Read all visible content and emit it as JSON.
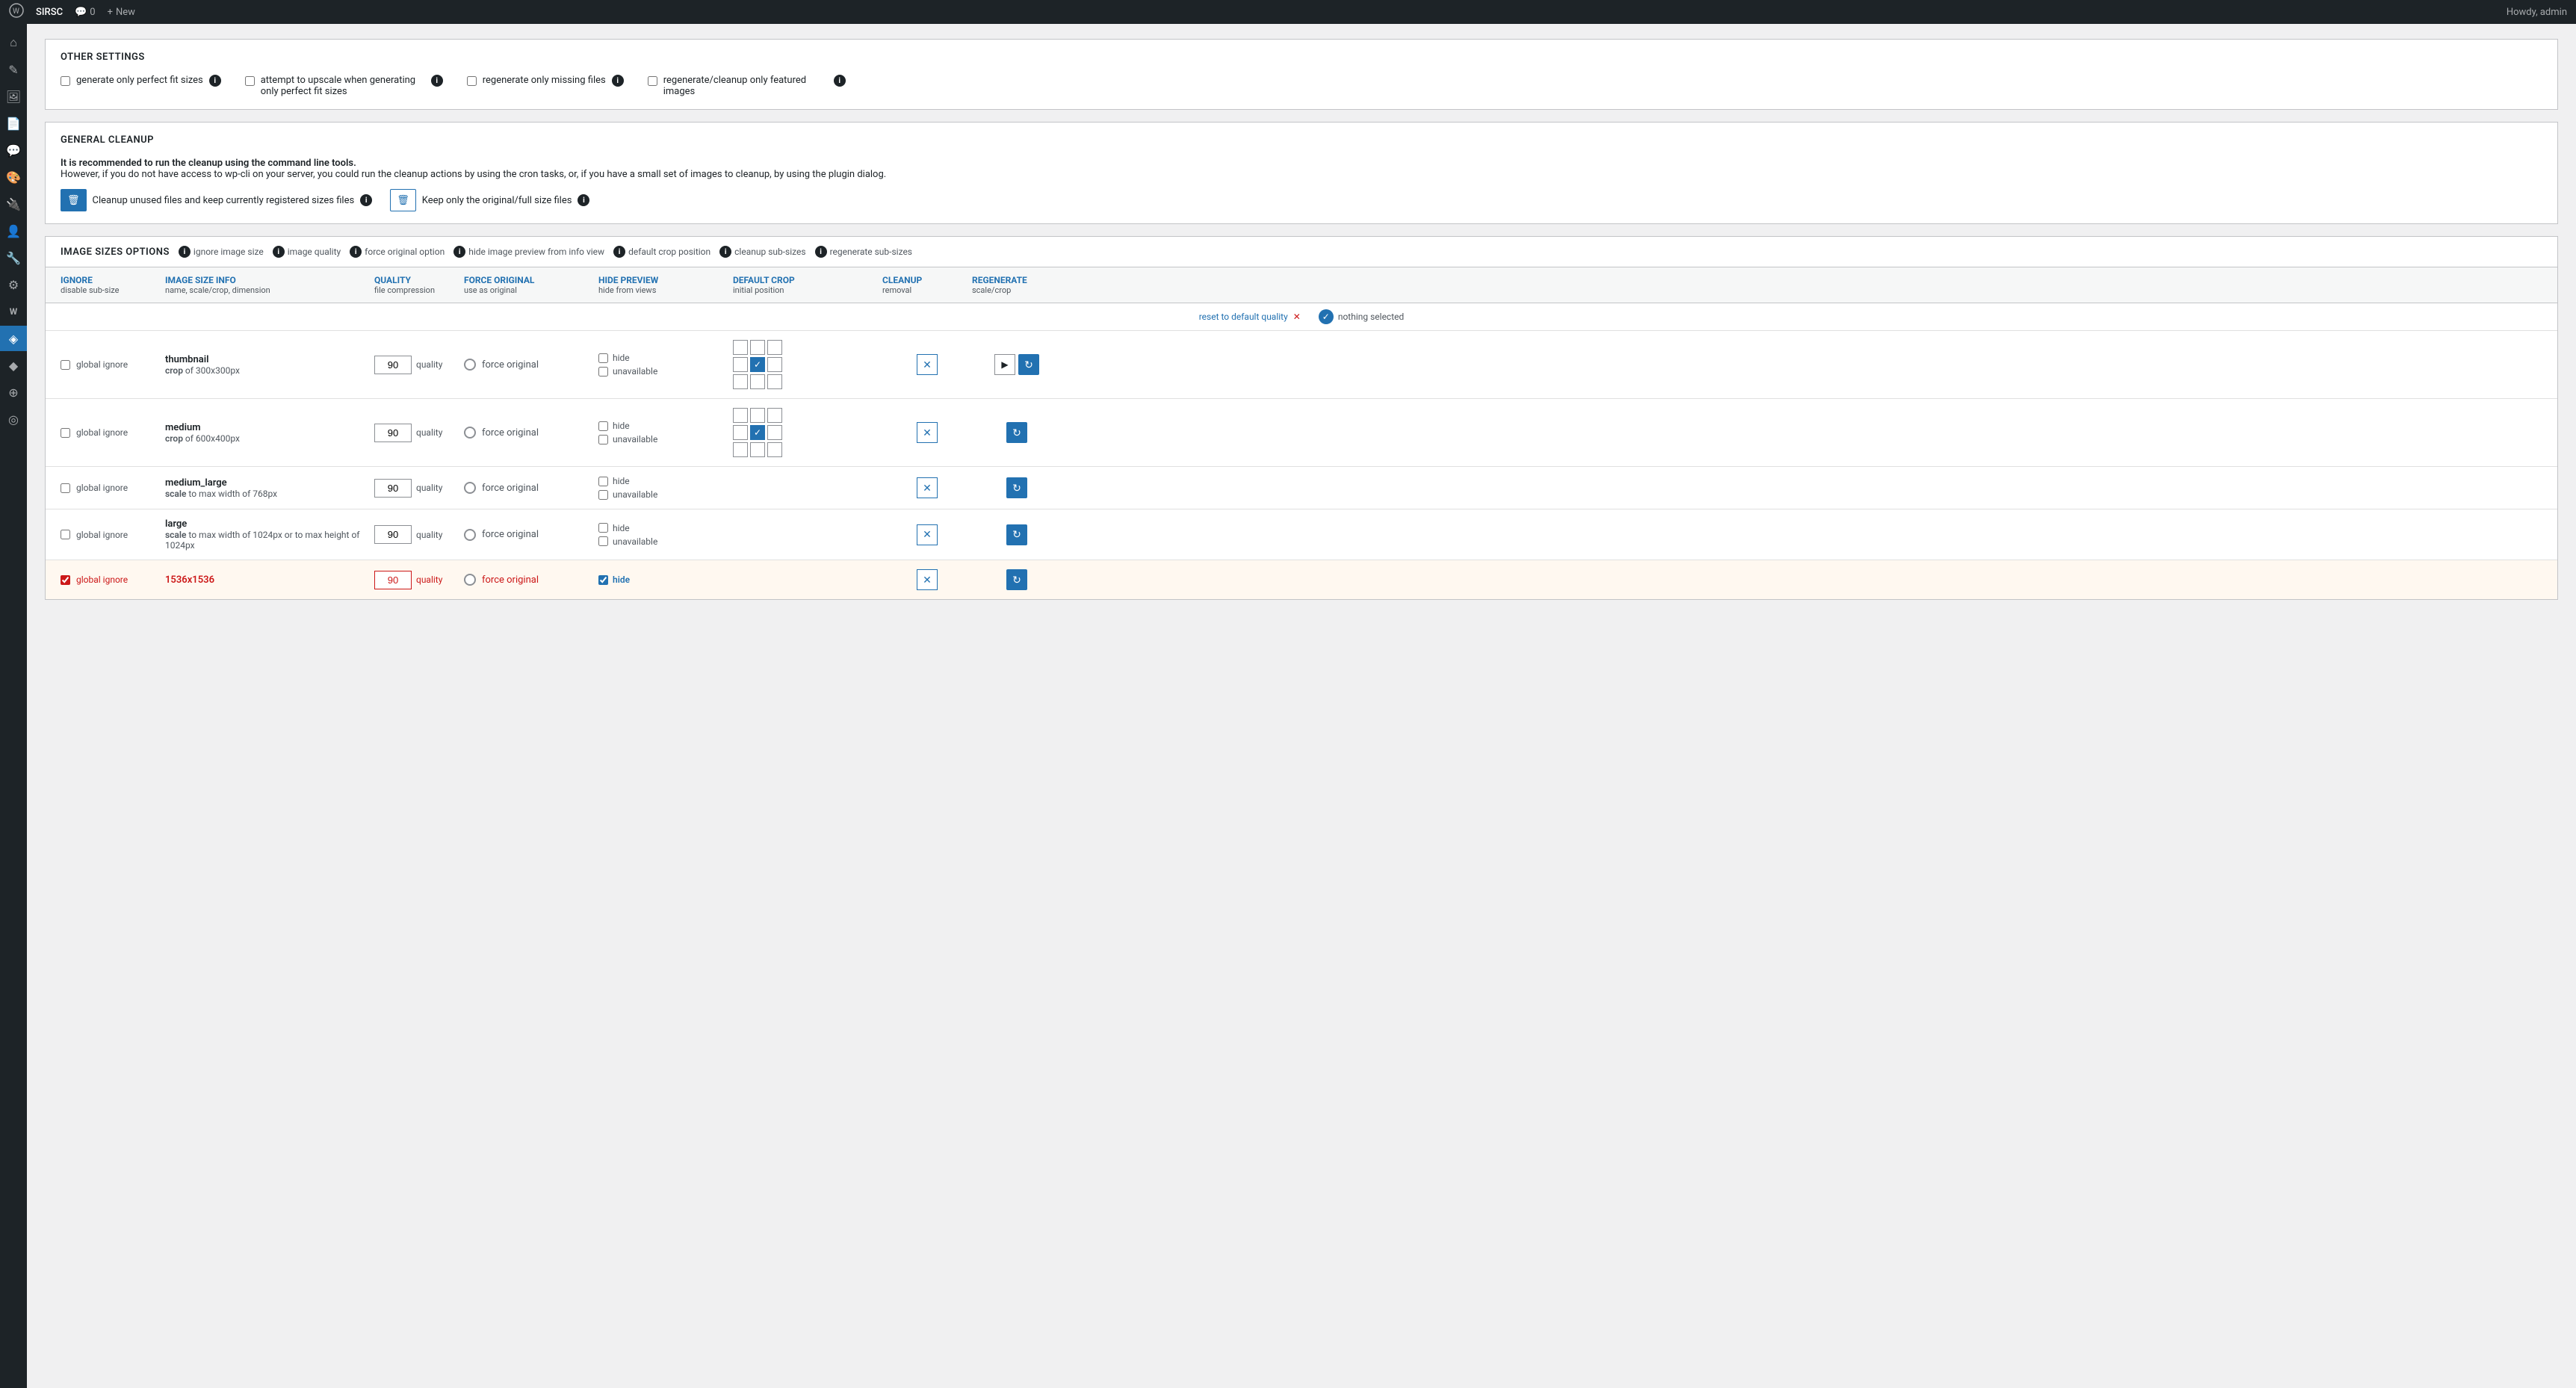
{
  "adminBar": {
    "logo": "wordpress-icon",
    "siteName": "SIRSC",
    "comments": "0",
    "newLabel": "New",
    "howdy": "Howdy, admin"
  },
  "sidebar": {
    "icons": [
      {
        "name": "dashboard-icon",
        "symbol": "⌂",
        "active": false
      },
      {
        "name": "posts-icon",
        "symbol": "📄",
        "active": false
      },
      {
        "name": "media-icon",
        "symbol": "🖼",
        "active": false
      },
      {
        "name": "pages-icon",
        "symbol": "📃",
        "active": false
      },
      {
        "name": "comments-icon",
        "symbol": "💬",
        "active": false
      },
      {
        "name": "appearance-icon",
        "symbol": "🎨",
        "active": false
      },
      {
        "name": "plugins-icon",
        "symbol": "🔌",
        "active": false
      },
      {
        "name": "users-icon",
        "symbol": "👤",
        "active": false
      },
      {
        "name": "tools-icon",
        "symbol": "🔧",
        "active": false
      },
      {
        "name": "settings-icon",
        "symbol": "⚙",
        "active": false
      },
      {
        "name": "woocommerce-icon",
        "symbol": "W",
        "active": false
      },
      {
        "name": "sirsc-icon",
        "symbol": "◈",
        "active": true
      },
      {
        "name": "misc-icon",
        "symbol": "◆",
        "active": false
      },
      {
        "name": "tools2-icon",
        "symbol": "⊕",
        "active": false
      },
      {
        "name": "analytics-icon",
        "symbol": "◎",
        "active": false
      }
    ]
  },
  "otherSettings": {
    "title": "OTHER SETTINGS",
    "checkboxes": [
      {
        "id": "gen-perfect-fit",
        "label": "generate only perfect fit sizes",
        "checked": false
      },
      {
        "id": "attempt-upscale",
        "label": "attempt to upscale when generating only perfect fit sizes",
        "checked": false
      },
      {
        "id": "regen-missing",
        "label": "regenerate only missing files",
        "checked": false
      },
      {
        "id": "regen-featured",
        "label": "regenerate/cleanup only featured images",
        "checked": false
      }
    ]
  },
  "generalCleanup": {
    "title": "GENERAL CLEANUP",
    "descBold": "It is recommended to run the cleanup using the command line tools.",
    "descNormal": "However, if you do not have access to wp-cli on your server, you could run the cleanup actions by using the cron tasks, or, if you have a small set of images to cleanup, by using the plugin dialog.",
    "buttons": [
      {
        "id": "cleanup-unused",
        "label": "Cleanup unused files and keep currently registered sizes files"
      },
      {
        "id": "keep-original",
        "label": "Keep only the original/full size files"
      }
    ]
  },
  "imageSizes": {
    "title": "IMAGE SIZES OPTIONS",
    "headerInfoItems": [
      {
        "label": "ignore image size"
      },
      {
        "label": "image quality"
      },
      {
        "label": "force original option"
      },
      {
        "label": "hide image preview from info view"
      },
      {
        "label": "default crop position"
      },
      {
        "label": "cleanup sub-sizes"
      },
      {
        "label": "regenerate sub-sizes"
      }
    ],
    "columns": [
      {
        "label": "IGNORE",
        "sub": "disable sub-size"
      },
      {
        "label": "IMAGE SIZE INFO",
        "sub": "name, scale/crop, dimension"
      },
      {
        "label": "QUALITY",
        "sub": "file compression"
      },
      {
        "label": "FORCE ORIGINAL",
        "sub": "use as original"
      },
      {
        "label": "HIDE PREVIEW",
        "sub": "hide from views"
      },
      {
        "label": "DEFAULT CROP",
        "sub": "initial position"
      },
      {
        "label": "CLEANUP",
        "sub": "removal"
      },
      {
        "label": "REGENERATE",
        "sub": "scale/crop"
      }
    ],
    "resetRow": {
      "resetLink": "reset to default quality",
      "nothingSelectedLabel": "nothing selected"
    },
    "rows": [
      {
        "id": "thumbnail",
        "ignore": false,
        "ignoreLabel": "global ignore",
        "highlighted": false,
        "sizeName": "thumbnail",
        "sizeDesc": "crop of 300x300px",
        "sizeDescBold": "crop",
        "quality": "90",
        "forceOriginal": false,
        "hideChecked": false,
        "unavailableChecked": false,
        "cropActivePos": [
          false,
          false,
          false,
          false,
          true,
          false,
          false,
          false,
          false
        ],
        "hasPlay": true
      },
      {
        "id": "medium",
        "ignore": false,
        "ignoreLabel": "global ignore",
        "highlighted": false,
        "sizeName": "medium",
        "sizeDesc": "crop of 600x400px",
        "sizeDescBold": "crop",
        "quality": "90",
        "forceOriginal": false,
        "hideChecked": false,
        "unavailableChecked": false,
        "cropActivePos": [
          false,
          false,
          false,
          false,
          true,
          false,
          false,
          false,
          false
        ],
        "hasPlay": false
      },
      {
        "id": "medium_large",
        "ignore": false,
        "ignoreLabel": "global ignore",
        "highlighted": false,
        "sizeName": "medium_large",
        "sizeDesc": "scale to max width of 768px",
        "sizeDescBold": "scale",
        "quality": "90",
        "forceOriginal": false,
        "hideChecked": false,
        "unavailableChecked": false,
        "cropActivePos": [],
        "hasPlay": false
      },
      {
        "id": "large",
        "ignore": false,
        "ignoreLabel": "global ignore",
        "highlighted": false,
        "sizeName": "large",
        "sizeDesc": "scale to max width of 1024px or to max height of 1024px",
        "sizeDescBold": "scale",
        "quality": "90",
        "forceOriginal": false,
        "hideChecked": false,
        "unavailableChecked": false,
        "cropActivePos": [],
        "hasPlay": false
      },
      {
        "id": "1536x1536",
        "ignore": true,
        "ignoreLabel": "global ignore",
        "highlighted": true,
        "sizeName": "1536x1536",
        "sizeDesc": "",
        "sizeDescBold": "",
        "quality": "90",
        "forceOriginal": false,
        "hideChecked": true,
        "unavailableChecked": false,
        "cropActivePos": [],
        "hasPlay": false,
        "isRed": true
      }
    ]
  }
}
